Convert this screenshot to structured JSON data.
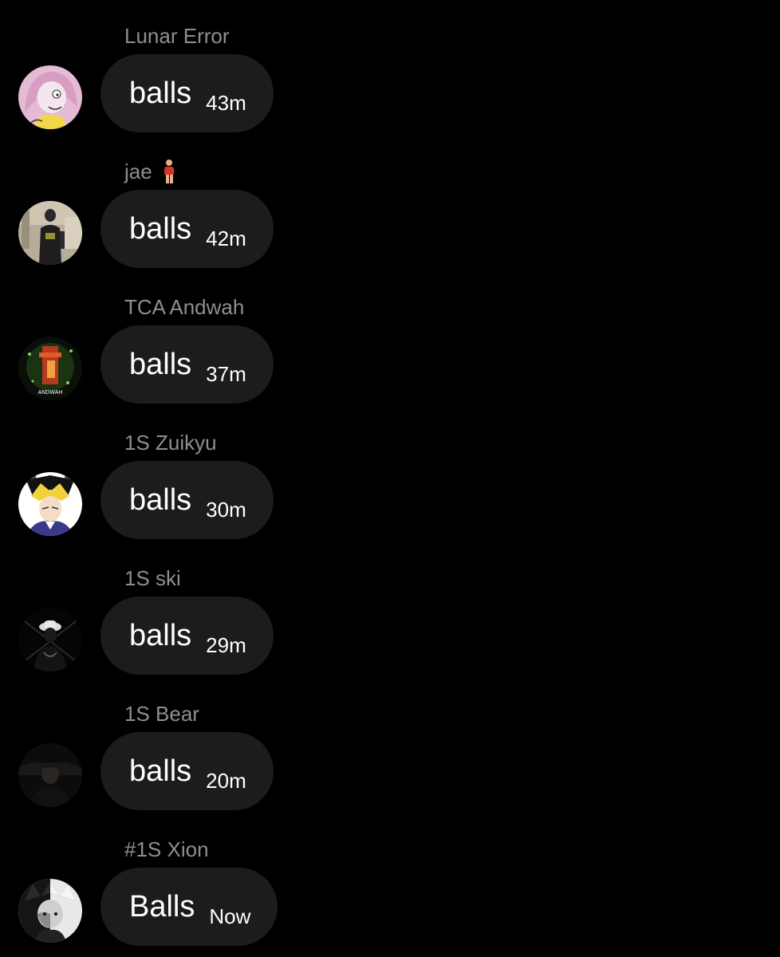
{
  "messages": [
    {
      "sender": "Lunar Error",
      "text": "balls",
      "time": "43m",
      "avatar": "cartoon-character-avatar",
      "sender_emoji": ""
    },
    {
      "sender": "jae",
      "text": "balls",
      "time": "42m",
      "avatar": "person-photo-avatar",
      "sender_emoji": "person-standing-emoji"
    },
    {
      "sender": "TCA Andwah",
      "text": "balls",
      "time": "37m",
      "avatar": "andwah-logo-avatar",
      "sender_emoji": ""
    },
    {
      "sender": "1S Zuikyu",
      "text": "balls",
      "time": "30m",
      "avatar": "anime-character-avatar",
      "sender_emoji": ""
    },
    {
      "sender": "1S ski",
      "text": "balls",
      "time": "29m",
      "avatar": "dark-figure-avatar",
      "sender_emoji": ""
    },
    {
      "sender": "1S Bear",
      "text": "balls",
      "time": "20m",
      "avatar": "dark-photo-avatar",
      "sender_emoji": ""
    },
    {
      "sender": "#1S Xion",
      "text": "Balls",
      "time": "Now",
      "avatar": "monochrome-anime-avatar",
      "sender_emoji": ""
    }
  ],
  "avatar_text": {
    "andwah": "ANDWAH"
  },
  "colors": {
    "background": "#000000",
    "bubble": "#1c1c1e",
    "sender_name": "#8e8e93",
    "message_text": "#ffffff"
  }
}
